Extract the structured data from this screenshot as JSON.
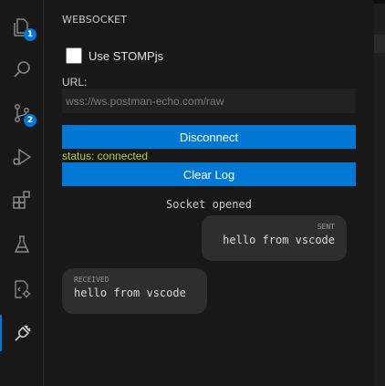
{
  "sidebar": {
    "title": "WEBSOCKET",
    "use_stomp_label": "Use STOMPjs",
    "use_stomp_checked": false,
    "url_label": "URL:",
    "url_placeholder": "wss://ws.postman-echo.com/raw",
    "url_value": "",
    "disconnect_label": "Disconnect",
    "status_text": "status: connected",
    "clear_log_label": "Clear Log"
  },
  "log": {
    "event_text": "Socket opened",
    "messages": [
      {
        "direction": "SENT",
        "text": "hello from vscode"
      },
      {
        "direction": "RECEIVED",
        "text": "hello from vscode"
      }
    ]
  },
  "activity_bar": {
    "items": [
      {
        "name": "explorer-icon",
        "badge": "1"
      },
      {
        "name": "search-icon",
        "badge": ""
      },
      {
        "name": "source-control-icon",
        "badge": "2"
      },
      {
        "name": "run-debug-icon",
        "badge": ""
      },
      {
        "name": "extensions-icon",
        "badge": ""
      },
      {
        "name": "testing-flask-icon",
        "badge": ""
      },
      {
        "name": "code-settings-icon",
        "badge": ""
      },
      {
        "name": "websocket-plug-icon",
        "badge": ""
      }
    ]
  },
  "colors": {
    "accent": "#0078d4",
    "status": "#b5cf3a",
    "background": "#181818",
    "bubble": "#2e2e2e"
  }
}
